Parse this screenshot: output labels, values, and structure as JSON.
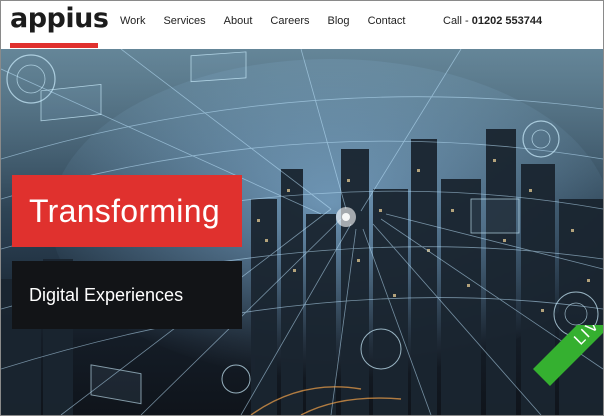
{
  "header": {
    "logo": "appius",
    "nav": [
      "Work",
      "Services",
      "About",
      "Careers",
      "Blog",
      "Contact"
    ],
    "phone_prefix": "Call - ",
    "phone_number": "01202 553744"
  },
  "hero": {
    "headline": "Transforming",
    "subheadline": "Digital Experiences"
  },
  "badge": {
    "label": "LIVE"
  },
  "colors": {
    "accent": "#e0312e",
    "dark_box": "#121417",
    "badge": "#35b030"
  }
}
